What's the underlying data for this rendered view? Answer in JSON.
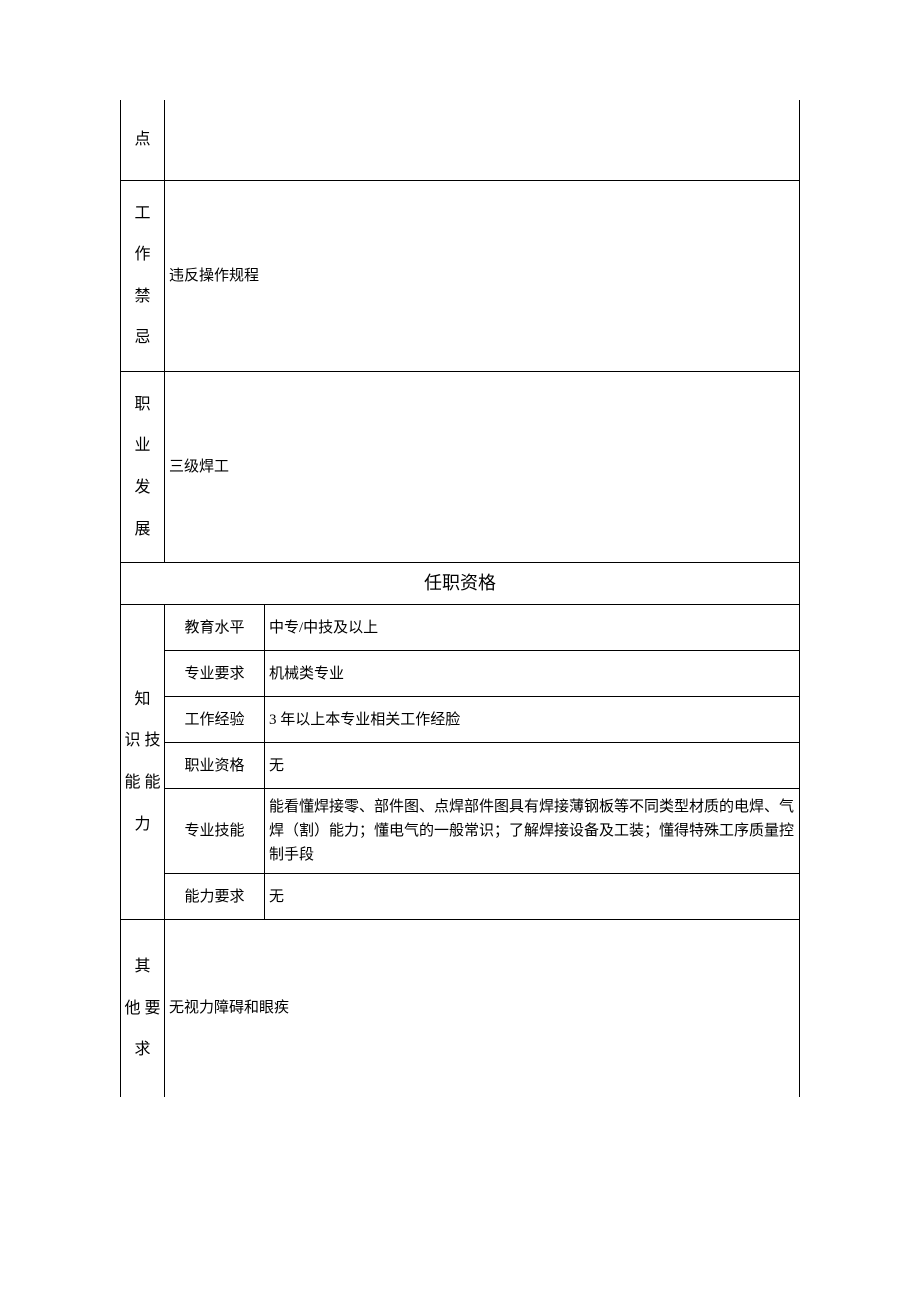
{
  "rows": {
    "dian": {
      "label": "点",
      "value": ""
    },
    "gzjj": {
      "c1": "工",
      "c2": "作",
      "c3": "禁",
      "c4": "忌",
      "value": "违反操作规程"
    },
    "zyfz": {
      "c1": "职",
      "c2": "业",
      "c3": "发",
      "c4": "展",
      "value": "三级焊工"
    }
  },
  "section_header": "任职资格",
  "zs": {
    "label_c1": "知",
    "label_c2": "识 技",
    "label_c3": "能 能",
    "label_c4": "力",
    "items": [
      {
        "label": "教育水平",
        "value": "中专/中技及以上"
      },
      {
        "label": "专业要求",
        "value": "机械类专业"
      },
      {
        "label": "工作经验",
        "value": "3 年以上本专业相关工作经脸"
      },
      {
        "label": "职业资格",
        "value": "无"
      },
      {
        "label": "专业技能",
        "value": "能看懂焊接零、部件图、点焊部件图具有焊接薄钢板等不同类型材质的电焊、气焊（割）能力；懂电气的一般常识；了解焊接设备及工装；懂得特殊工序质量控制手段"
      },
      {
        "label": "能力要求",
        "value": "无"
      }
    ]
  },
  "other": {
    "c1": "其",
    "c2": "他 要",
    "c3": "求",
    "value": "无视力障碍和眼疾"
  }
}
